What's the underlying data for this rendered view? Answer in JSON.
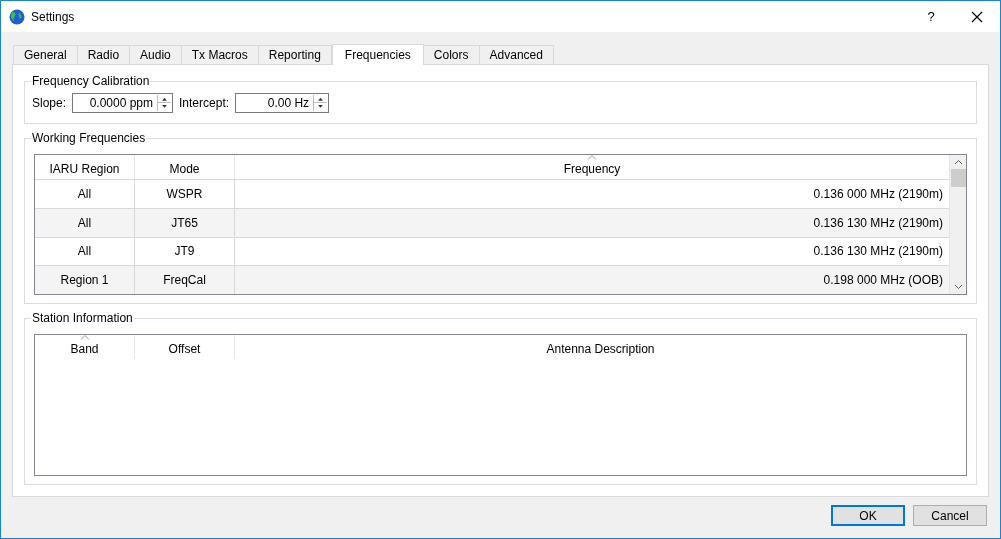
{
  "window": {
    "title": "Settings",
    "help": "?"
  },
  "tabs": [
    {
      "label": "General",
      "selected": false
    },
    {
      "label": "Radio",
      "selected": false
    },
    {
      "label": "Audio",
      "selected": false
    },
    {
      "label": "Tx Macros",
      "selected": false
    },
    {
      "label": "Reporting",
      "selected": false
    },
    {
      "label": "Frequencies",
      "selected": true
    },
    {
      "label": "Colors",
      "selected": false
    },
    {
      "label": "Advanced",
      "selected": false
    }
  ],
  "frequency_calibration": {
    "title": "Frequency Calibration",
    "fields": [
      {
        "label": "Slope:",
        "value": "0.0000 ppm"
      },
      {
        "label": "Intercept:",
        "value": "0.00 Hz"
      }
    ]
  },
  "working_frequencies": {
    "title": "Working Frequencies",
    "columns": [
      {
        "label": "IARU Region",
        "sorted": false
      },
      {
        "label": "Mode",
        "sorted": false
      },
      {
        "label": "Frequency",
        "sorted": true
      }
    ],
    "rows": [
      [
        "All",
        "WSPR",
        "0.136 000 MHz (2190m)"
      ],
      [
        "All",
        "JT65",
        "0.136 130 MHz (2190m)"
      ],
      [
        "All",
        "JT9",
        "0.136 130 MHz (2190m)"
      ],
      [
        "Region 1",
        "FreqCal",
        "0.198 000 MHz (OOB)"
      ]
    ]
  },
  "station_information": {
    "title": "Station Information",
    "columns": [
      {
        "label": "Band",
        "sorted": true
      },
      {
        "label": "Offset",
        "sorted": false
      },
      {
        "label": "Antenna Description",
        "sorted": false
      }
    ]
  },
  "buttons": [
    {
      "label": "OK",
      "default": true
    },
    {
      "label": "Cancel",
      "default": false
    }
  ]
}
